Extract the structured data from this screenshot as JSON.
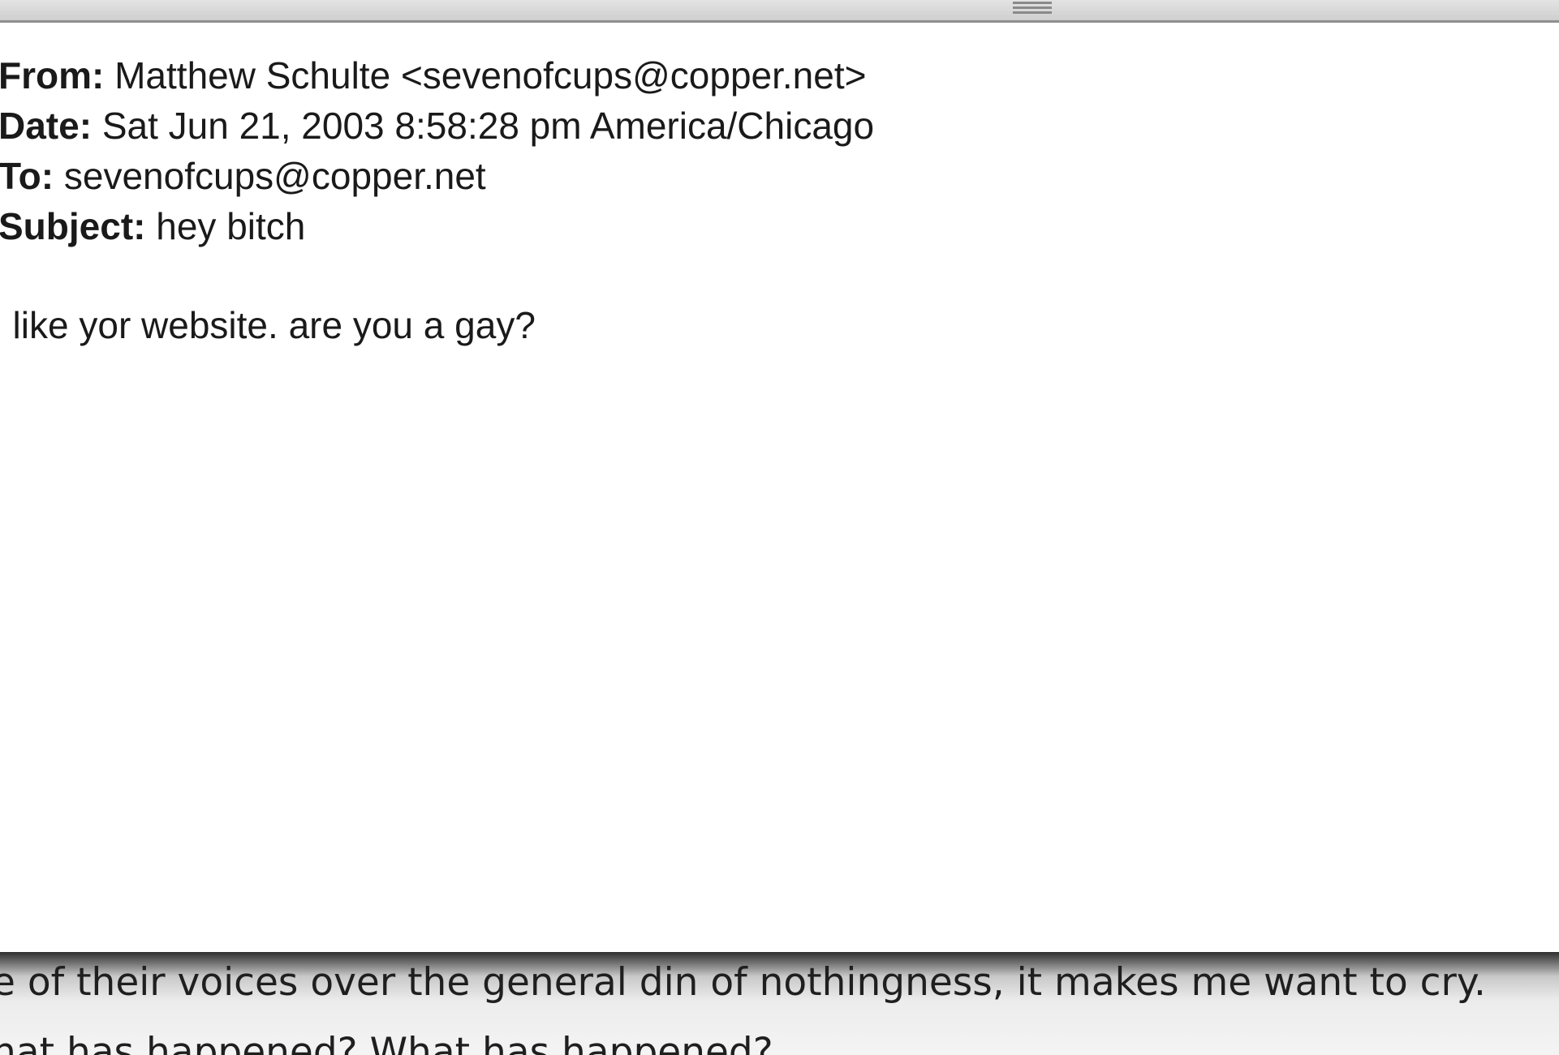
{
  "email": {
    "from_label": "From:",
    "from_value": "Matthew Schulte <sevenofcups@copper.net>",
    "date_label": "Date:",
    "date_value": "Sat Jun 21, 2003  8:58:28 pm America/Chicago",
    "to_label": "To:",
    "to_value": "sevenofcups@copper.net",
    "subject_label": "Subject:",
    "subject_value": "hey bitch",
    "body": "I like yor website. are you a gay?"
  },
  "background_window": {
    "line1": "e of their voices over the general din of nothingness, it makes me want to cry.",
    "line2": "hat has happened? What has happened?"
  }
}
